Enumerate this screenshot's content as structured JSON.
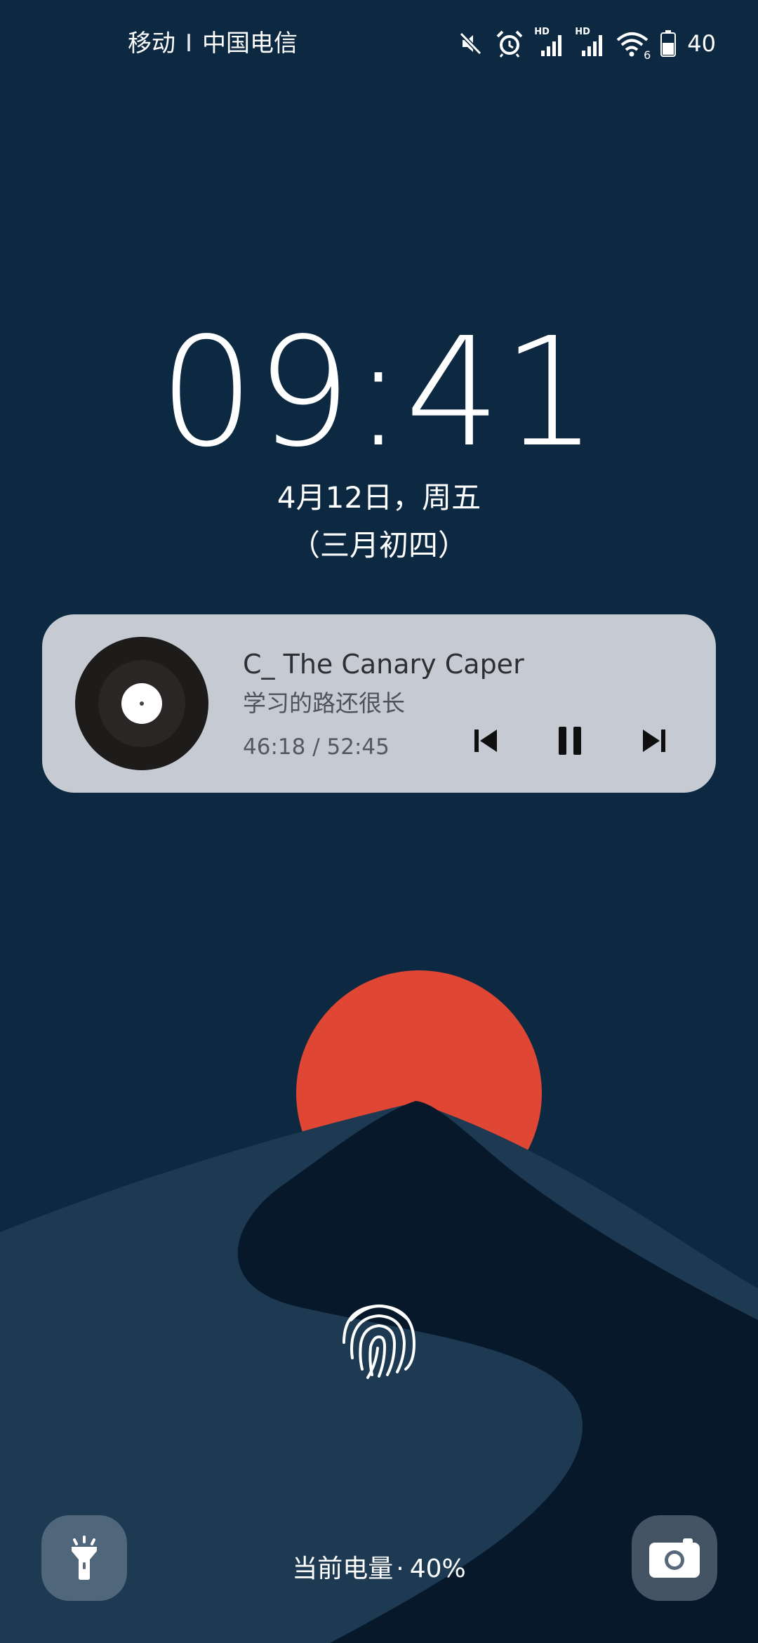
{
  "status_bar": {
    "carrier_1": "移动",
    "divider": "I",
    "carrier_2": "中国电信",
    "hd_1": "HD",
    "hd_2": "HD",
    "wifi_tag": "6",
    "battery_level": "40",
    "icons": [
      "mute-icon",
      "alarm-icon",
      "signal-icon",
      "signal-icon",
      "wifi-icon",
      "battery-icon"
    ]
  },
  "lockscreen": {
    "time": "09:41",
    "date": "4月12日，周五",
    "lunar_date": "（三月初四）"
  },
  "music": {
    "title": "C_ The Canary Caper",
    "artist": "学习的路还很长",
    "elapsed": "46:18",
    "separator": "/",
    "duration": "52:45",
    "controls": [
      "previous-icon",
      "pause-icon",
      "next-icon"
    ]
  },
  "bottom": {
    "battery_label": "当前电量",
    "battery_sep": "·",
    "battery_percent": "40%",
    "left_shortcut": "flashlight-icon",
    "right_shortcut": "camera-icon"
  },
  "colors": {
    "background": "#0c2941",
    "sun": "#e04634",
    "dune_light": "#1d3a52",
    "dune_dark": "#06182a",
    "card": "#c6cbd3"
  }
}
